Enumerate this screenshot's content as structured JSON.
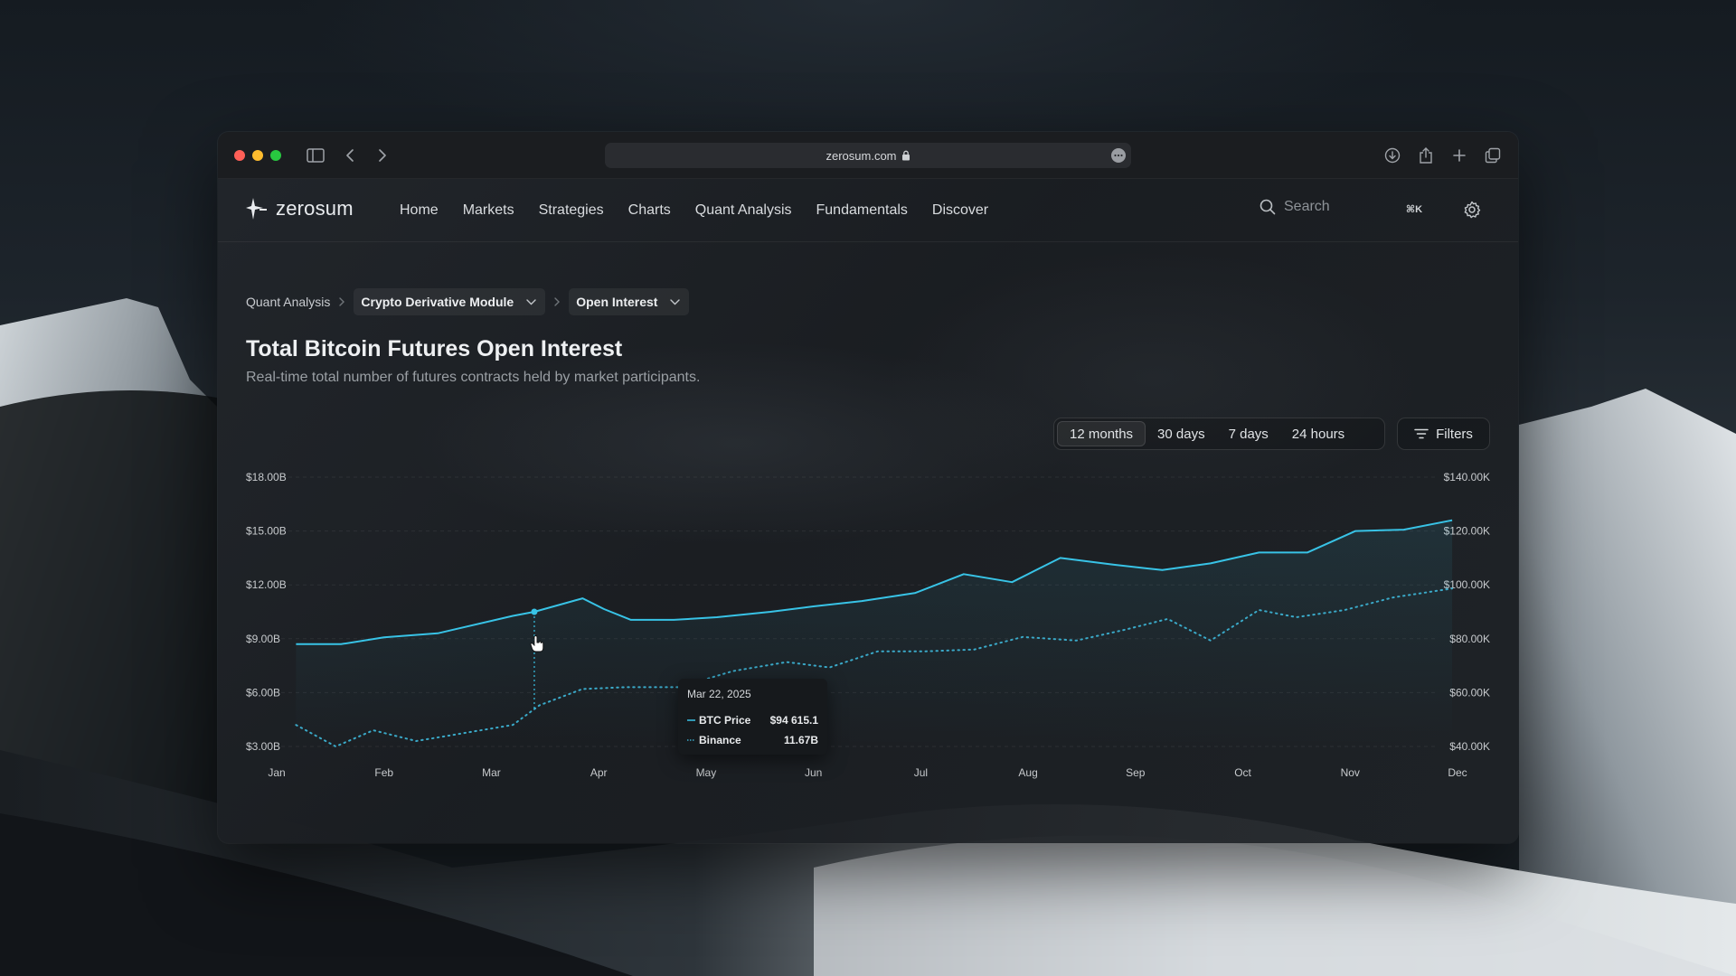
{
  "browser": {
    "url": "zerosum.com"
  },
  "app": {
    "logo_text": "zerosum",
    "nav": [
      "Home",
      "Markets",
      "Strategies",
      "Charts",
      "Quant Analysis",
      "Fundamentals",
      "Discover"
    ],
    "search_placeholder": "Search",
    "search_shortcut": "⌘K"
  },
  "breadcrumb": {
    "root": "Quant Analysis",
    "module": "Crypto Derivative Module",
    "page": "Open Interest"
  },
  "page": {
    "title": "Total Bitcoin Futures Open Interest",
    "subtitle": "Real-time total number of futures contracts held by market participants."
  },
  "range_options": [
    "12 months",
    "30 days",
    "7 days",
    "24 hours"
  ],
  "range_selected": "12 months",
  "filters_label": "Filters",
  "tooltip": {
    "date": "Mar 22, 2025",
    "rows": [
      {
        "name": "BTC Price",
        "value": "$94 615.1"
      },
      {
        "name": "Binance",
        "value": "11.67B"
      }
    ]
  },
  "colors": {
    "accent": "#38c3e6",
    "dotted": "#3aa9c8"
  },
  "chart_data": {
    "type": "line",
    "left_axis_ticks": [
      "$18.00B",
      "$15.00B",
      "$12.00B",
      "$9.00B",
      "$6.00B",
      "$3.00B"
    ],
    "right_axis_ticks": [
      "$140.00K",
      "$120.00K",
      "$100.00K",
      "$80.00K",
      "$60.00K",
      "$40.00K"
    ],
    "x_ticks": [
      "Jan",
      "Feb",
      "Mar",
      "Apr",
      "May",
      "Jun",
      "Jul",
      "Aug",
      "Sep",
      "Oct",
      "Nov",
      "Dec"
    ],
    "left_ylim": [
      3,
      18
    ],
    "right_ylim": [
      40,
      140
    ],
    "x_range": [
      0,
      11
    ],
    "grid": true,
    "series": [
      {
        "name": "BTC Price",
        "axis": "right",
        "style": "solid",
        "x": [
          0.18,
          0.6,
          1.0,
          1.5,
          2.2,
          2.4,
          2.85,
          3.05,
          3.3,
          3.7,
          4.1,
          4.6,
          5.0,
          5.45,
          5.95,
          6.4,
          6.85,
          7.3,
          7.8,
          8.25,
          8.7,
          9.15,
          9.6,
          10.05,
          10.5,
          10.95
        ],
        "y": [
          78,
          78,
          80.5,
          82,
          88.5,
          90,
          95,
          91,
          87,
          87,
          88,
          90,
          92,
          94,
          97,
          104,
          101,
          110,
          107.5,
          105.5,
          108,
          112,
          112,
          120,
          120.5,
          124
        ]
      },
      {
        "name": "Binance",
        "axis": "left",
        "style": "dotted",
        "x": [
          0.18,
          0.55,
          0.9,
          1.3,
          1.8,
          2.2,
          2.45,
          2.85,
          3.25,
          3.75,
          4.25,
          4.75,
          5.15,
          5.6,
          6.05,
          6.5,
          6.95,
          7.45,
          7.9,
          8.3,
          8.7,
          9.15,
          9.5,
          9.95,
          10.4,
          10.95
        ],
        "y": [
          4.2,
          3.0,
          3.9,
          3.3,
          3.8,
          4.2,
          5.3,
          6.2,
          6.3,
          6.3,
          7.2,
          7.7,
          7.4,
          8.3,
          8.3,
          8.4,
          9.1,
          8.9,
          9.5,
          10.1,
          8.9,
          10.6,
          10.2,
          10.6,
          11.3,
          11.8
        ]
      }
    ],
    "hover_x": 2.4
  }
}
